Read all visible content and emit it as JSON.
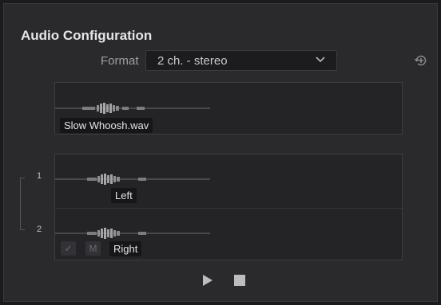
{
  "panel": {
    "title": "Audio Configuration"
  },
  "format": {
    "label": "Format",
    "value": "2 ch. - stereo"
  },
  "source_clip": {
    "name": "Slow Whoosh.wav"
  },
  "channels": [
    {
      "number": "1",
      "label": "Left"
    },
    {
      "number": "2",
      "label": "Right"
    }
  ],
  "channel_controls": {
    "enable_check": "✓",
    "mute_label": "M"
  },
  "icons": {
    "reset": "reset-history-icon",
    "dropdown": "chevron-down-icon",
    "play": "play-icon",
    "stop": "stop-icon"
  },
  "colors": {
    "panel_bg": "#2a2a2d",
    "box_bg": "#242427",
    "waveform": "#8f8f93",
    "tag_bg": "#161618"
  }
}
